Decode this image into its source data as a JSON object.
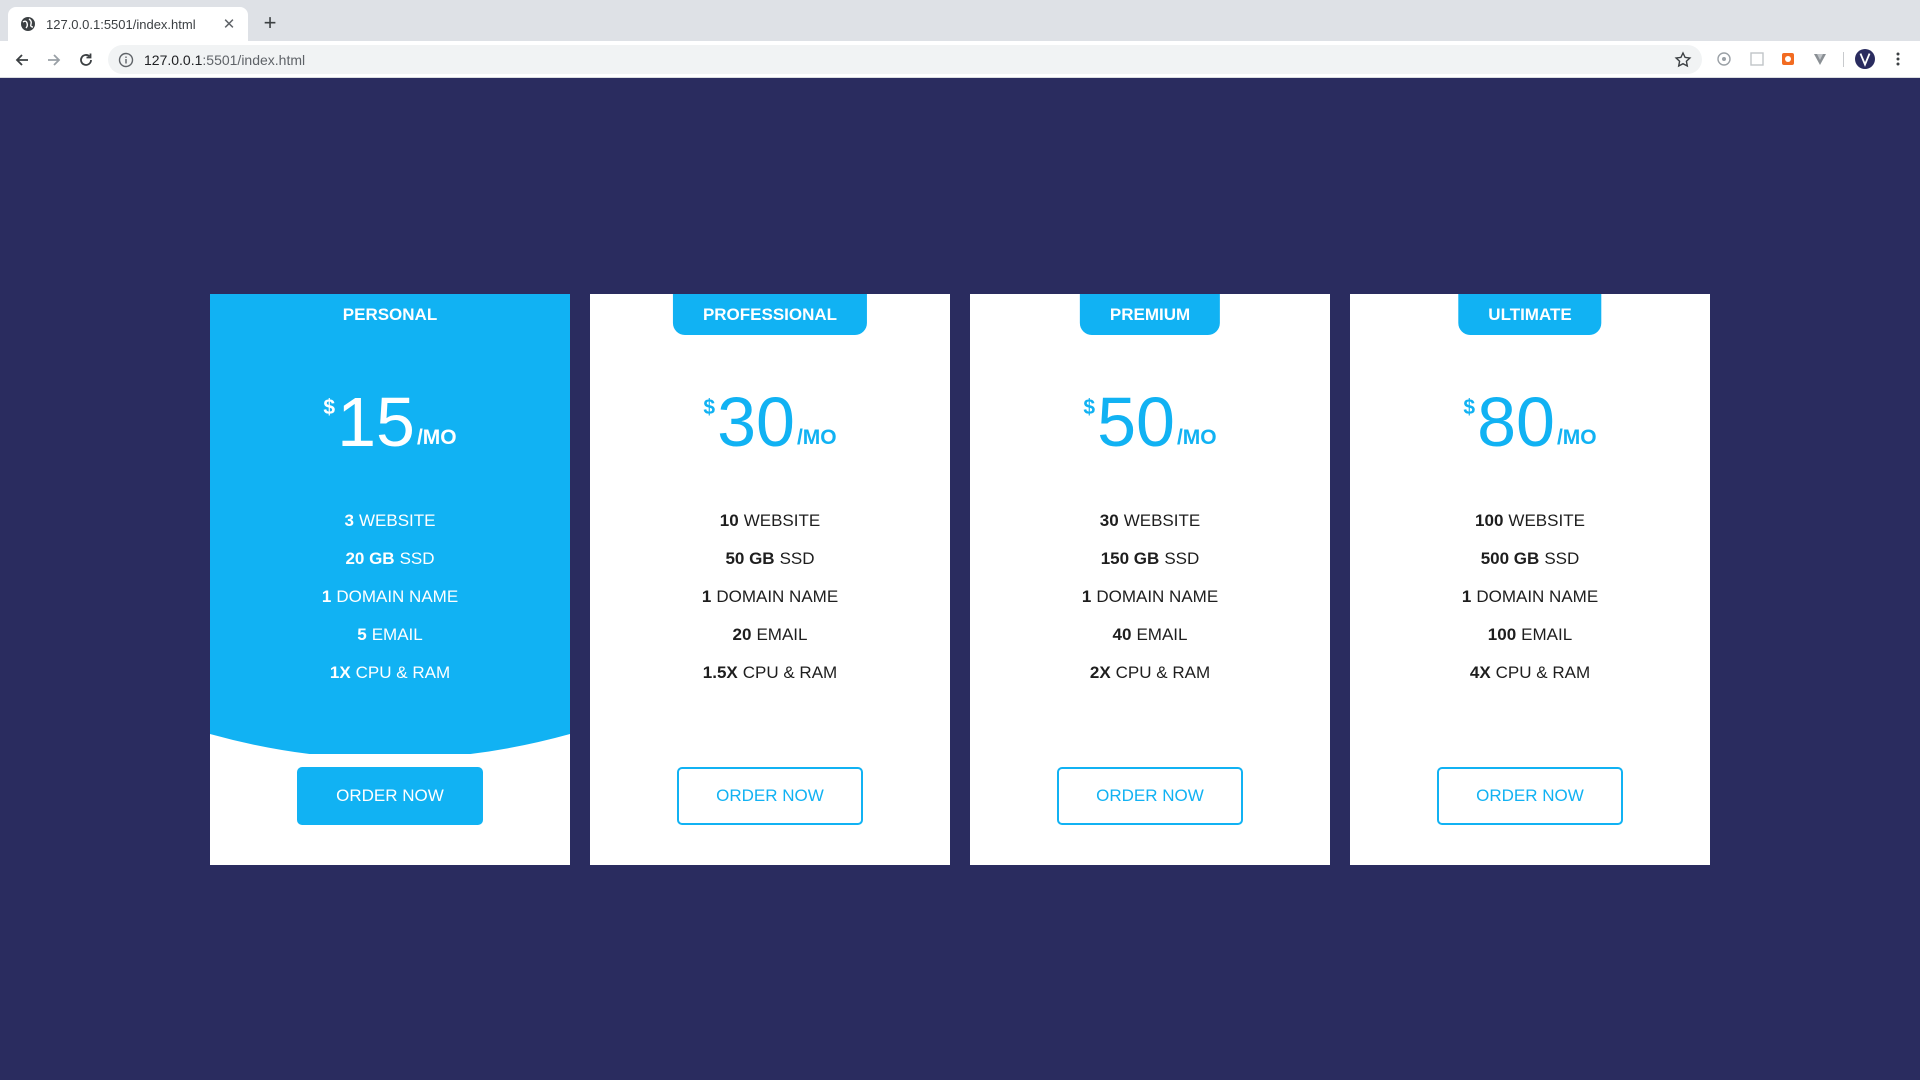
{
  "browser": {
    "tab_title": "127.0.0.1:5501/index.html",
    "tab_close_glyph": "✕",
    "new_tab_glyph": "+",
    "url_host": "127.0.0.1",
    "url_rest": ":5501/index.html",
    "icons": [
      "globe-icon",
      "back-arrow-icon",
      "forward-arrow-icon",
      "reload-icon",
      "info-icon",
      "star-icon",
      "extension-icon",
      "profile-icon",
      "more-menu-icon"
    ]
  },
  "colors": {
    "page_background": "#2a2c5f",
    "accent": "#11b2f3",
    "card_background": "#ffffff",
    "text": "#1e1e1e"
  },
  "plans": [
    {
      "name": "PERSONAL",
      "featured": true,
      "currency": "$",
      "price": "15",
      "period": "/MO",
      "features": [
        {
          "qty": "3",
          "label": "WEBSITE"
        },
        {
          "qty": "20 GB",
          "label": "SSD"
        },
        {
          "qty": "1",
          "label": "DOMAIN NAME"
        },
        {
          "qty": "5",
          "label": "EMAIL"
        },
        {
          "qty": "1X",
          "label": "CPU & RAM"
        }
      ],
      "button": "ORDER NOW"
    },
    {
      "name": "PROFESSIONAL",
      "featured": false,
      "currency": "$",
      "price": "30",
      "period": "/MO",
      "features": [
        {
          "qty": "10",
          "label": "WEBSITE"
        },
        {
          "qty": "50 GB",
          "label": "SSD"
        },
        {
          "qty": "1",
          "label": "DOMAIN NAME"
        },
        {
          "qty": "20",
          "label": "EMAIL"
        },
        {
          "qty": "1.5X",
          "label": "CPU & RAM"
        }
      ],
      "button": "ORDER NOW"
    },
    {
      "name": "PREMIUM",
      "featured": false,
      "currency": "$",
      "price": "50",
      "period": "/MO",
      "features": [
        {
          "qty": "30",
          "label": "WEBSITE"
        },
        {
          "qty": "150 GB",
          "label": "SSD"
        },
        {
          "qty": "1",
          "label": "DOMAIN NAME"
        },
        {
          "qty": "40",
          "label": "EMAIL"
        },
        {
          "qty": "2X",
          "label": "CPU & RAM"
        }
      ],
      "button": "ORDER NOW"
    },
    {
      "name": "ULTIMATE",
      "featured": false,
      "currency": "$",
      "price": "80",
      "period": "/MO",
      "features": [
        {
          "qty": "100",
          "label": "WEBSITE"
        },
        {
          "qty": "500 GB",
          "label": "SSD"
        },
        {
          "qty": "1",
          "label": "DOMAIN NAME"
        },
        {
          "qty": "100",
          "label": "EMAIL"
        },
        {
          "qty": "4X",
          "label": "CPU & RAM"
        }
      ],
      "button": "ORDER NOW"
    }
  ]
}
